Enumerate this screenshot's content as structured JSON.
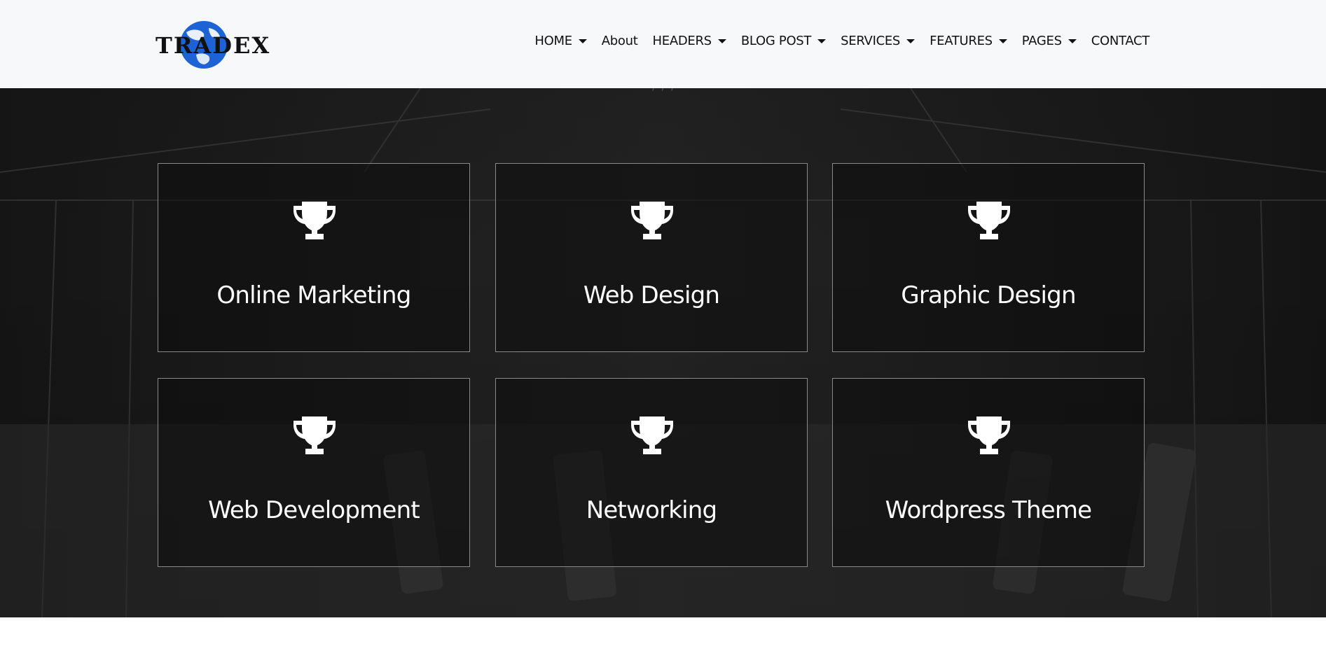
{
  "brand": {
    "logo_text": "TRADEX",
    "logo_color": "#1e63d6"
  },
  "nav": {
    "items": [
      {
        "label": "HOME",
        "dropdown": true
      },
      {
        "label": "About",
        "dropdown": false
      },
      {
        "label": "HEADERS",
        "dropdown": true
      },
      {
        "label": "BLOG POST",
        "dropdown": true
      },
      {
        "label": "SERVICES",
        "dropdown": true
      },
      {
        "label": "FEATURES",
        "dropdown": true
      },
      {
        "label": "PAGES",
        "dropdown": true
      },
      {
        "label": "CONTACT",
        "dropdown": false
      }
    ]
  },
  "services": {
    "icon": "trophy-icon",
    "cards": [
      {
        "title": "Online Marketing"
      },
      {
        "title": "Web Design"
      },
      {
        "title": "Graphic Design"
      },
      {
        "title": "Web Development"
      },
      {
        "title": "Networking"
      },
      {
        "title": "Wordpress Theme"
      }
    ]
  },
  "colors": {
    "header_bg": "#f7f8fa",
    "section_bg": "#1b1b1b",
    "card_border": "#8a8a8a",
    "text_light": "#ffffff",
    "text_dark": "#111111"
  }
}
